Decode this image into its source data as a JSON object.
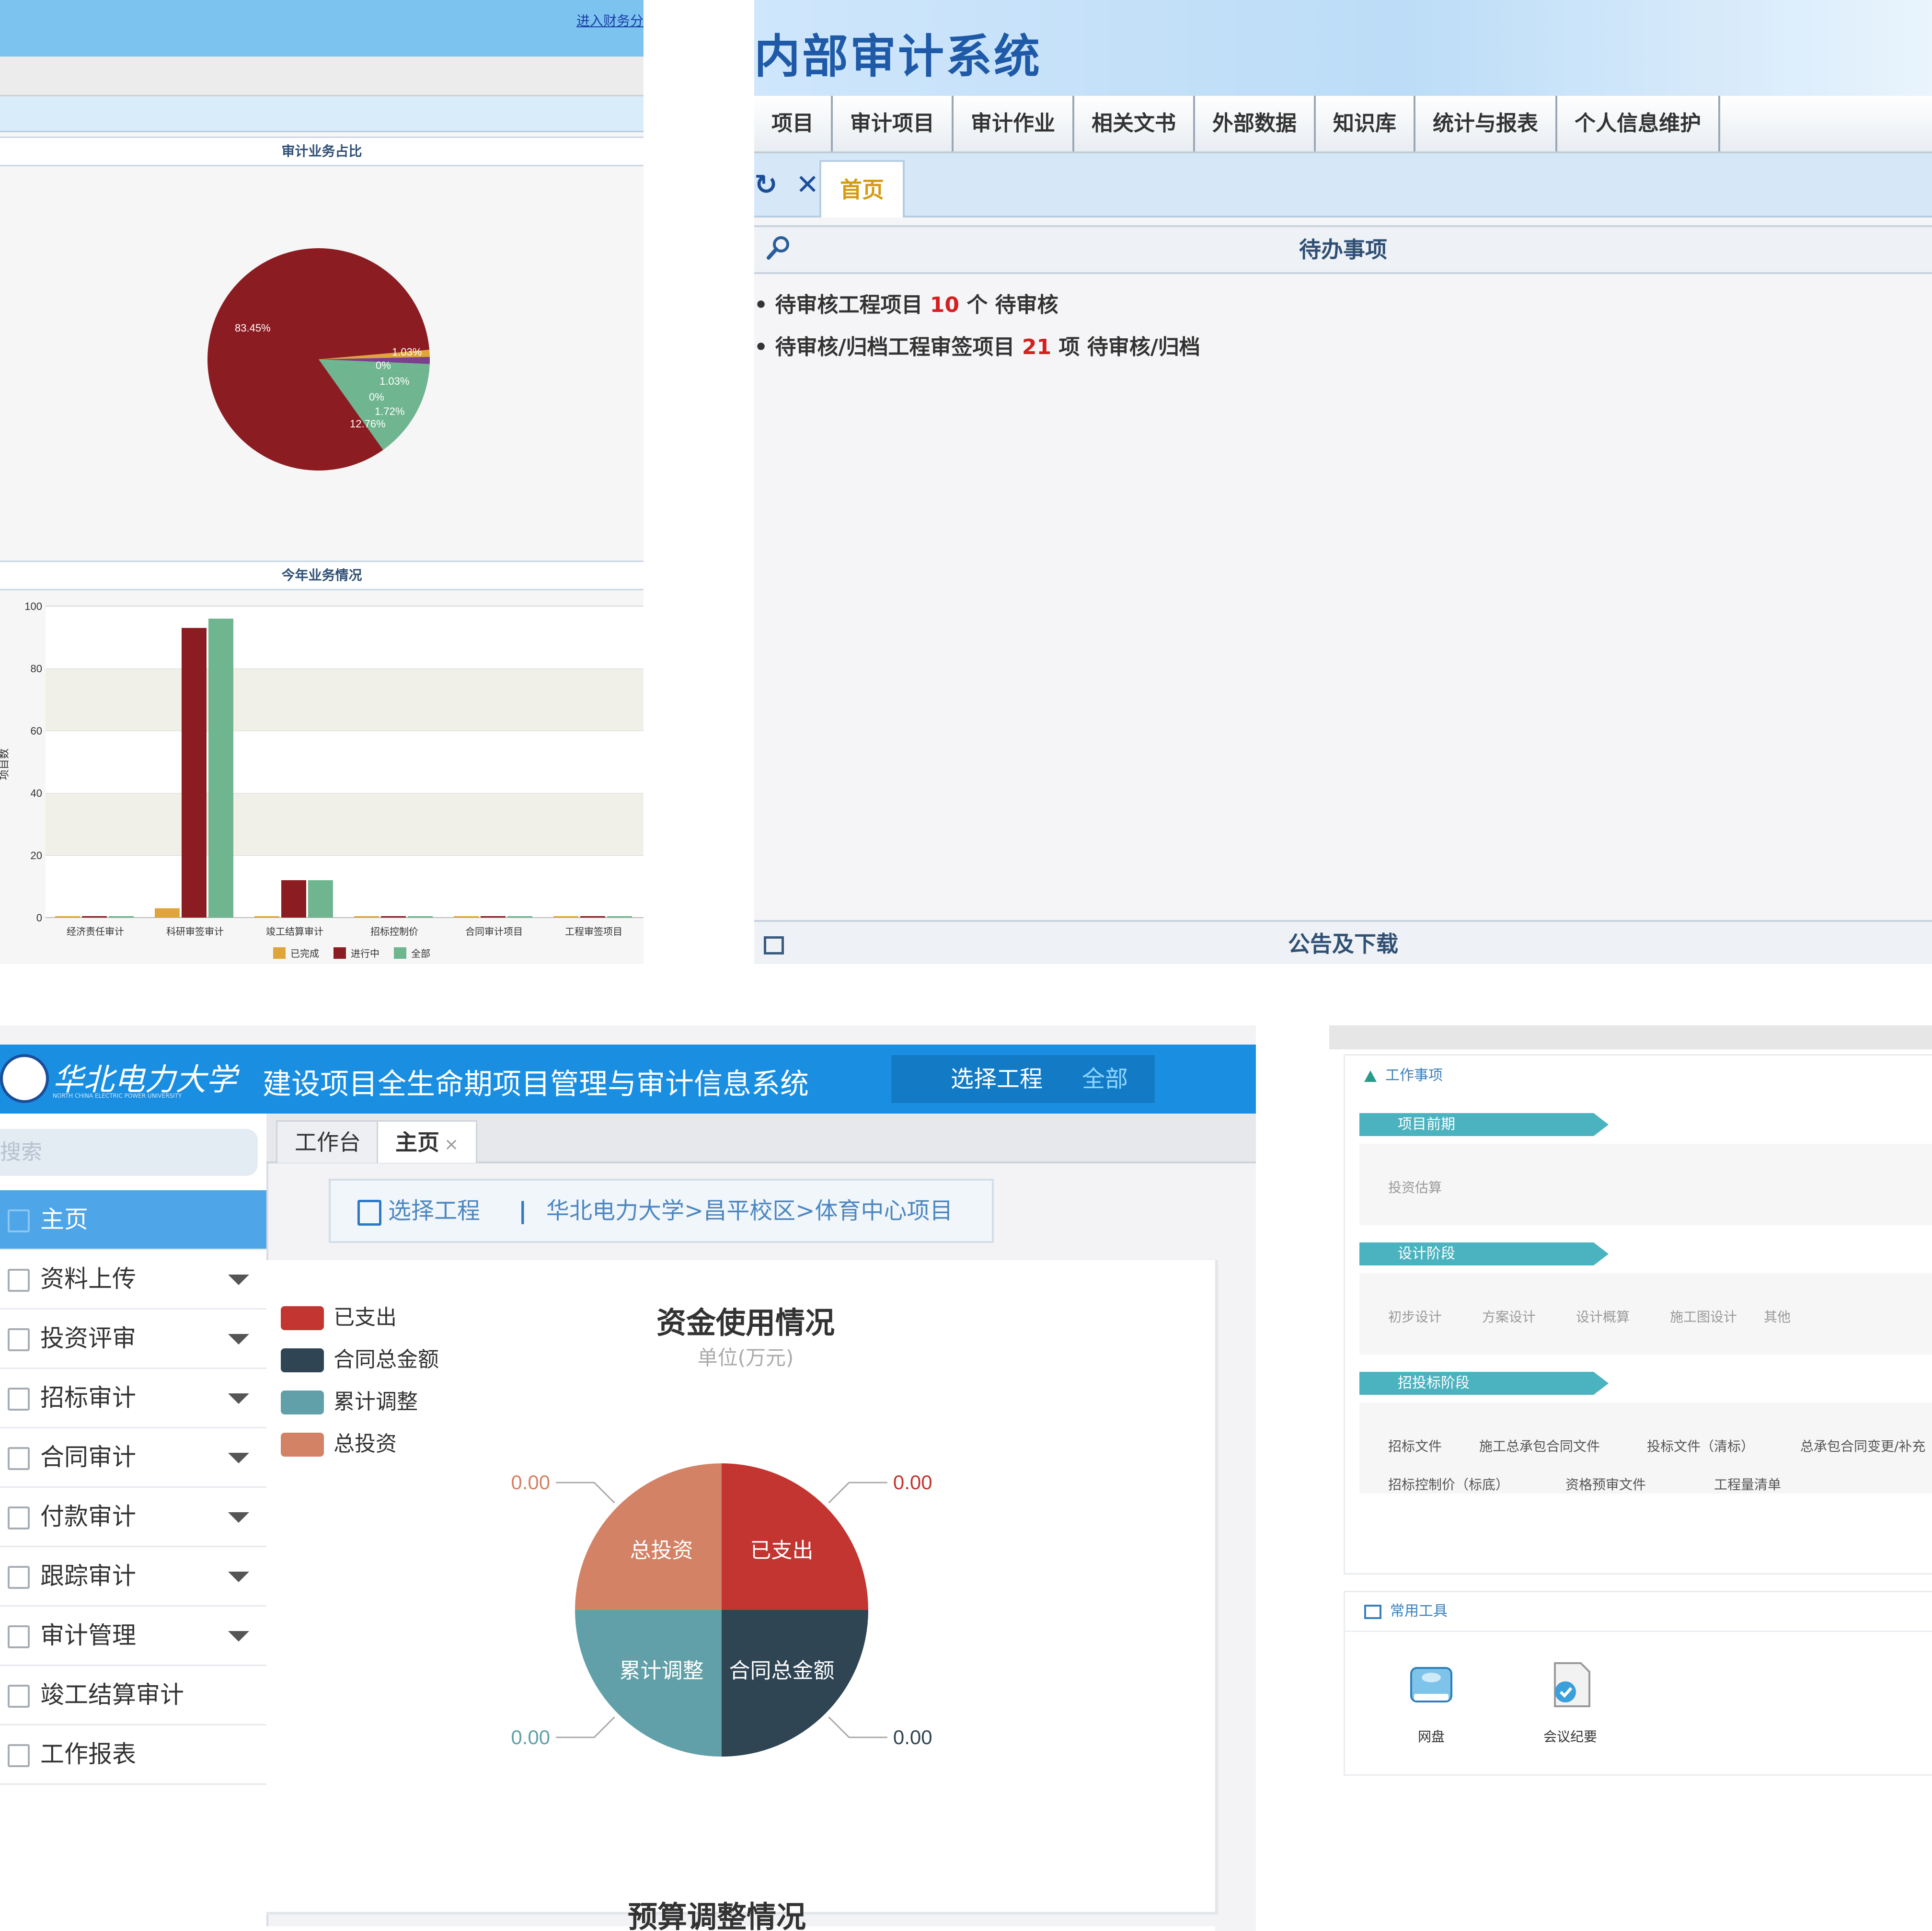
{
  "panel1": {
    "top_link": "进入财务分",
    "pie_section_title": "审计业务占比",
    "bar_section_title": "今年业务情况"
  },
  "panel2": {
    "system_title": "内部审计系统",
    "menu": [
      "项目",
      "审计项目",
      "审计作业",
      "相关文书",
      "外部数据",
      "知识库",
      "统计与报表",
      "个人信息维护"
    ],
    "home_tab": "首页",
    "todo_title": "待办事项",
    "todo_items": [
      {
        "before": "待审核工程项目 ",
        "num": "10",
        "after": " 个 待审核"
      },
      {
        "before": "待审核/归档工程审签项目 ",
        "num": "21",
        "after": " 项 待审核/归档"
      }
    ],
    "announce_title": "公告及下载"
  },
  "panel3": {
    "logo_text": "华北电力大学",
    "logo_subtext": "NORTH CHINA ELECTRIC POWER UNIVERSITY",
    "system_title": "建设项目全生命期项目管理与审计信息系统",
    "select_project_label": "选择工程",
    "select_project_value": "全部",
    "search_placeholder": "搜索",
    "nav": [
      {
        "label": "主页",
        "active": true,
        "arrow": false
      },
      {
        "label": "资料上传",
        "active": false,
        "arrow": true
      },
      {
        "label": "投资评审",
        "active": false,
        "arrow": true
      },
      {
        "label": "招标审计",
        "active": false,
        "arrow": true
      },
      {
        "label": "合同审计",
        "active": false,
        "arrow": true
      },
      {
        "label": "付款审计",
        "active": false,
        "arrow": true
      },
      {
        "label": "跟踪审计",
        "active": false,
        "arrow": true
      },
      {
        "label": "审计管理",
        "active": false,
        "arrow": true
      },
      {
        "label": "竣工结算审计",
        "active": false,
        "arrow": false
      },
      {
        "label": "工作报表",
        "active": false,
        "arrow": false
      }
    ],
    "tabs": [
      {
        "label": "工作台",
        "active": false
      },
      {
        "label": "主页",
        "active": true,
        "close": "×"
      }
    ],
    "crumb_select": "选择工程",
    "crumb_sep": "|",
    "crumb_path": "华北电力大学>昌平校区>体育中心项目",
    "fund_title": "资金使用情况",
    "fund_unit": "单位(万元)",
    "legend": [
      {
        "label": "已支出",
        "color": "#c23531"
      },
      {
        "label": "合同总金额",
        "color": "#2f4554"
      },
      {
        "label": "累计调整",
        "color": "#61a0a8"
      },
      {
        "label": "总投资",
        "color": "#d48265"
      }
    ],
    "budget_title": "预算调整情况"
  },
  "panel4": {
    "work_items_title": "工作事项",
    "stages": [
      {
        "label": "项目前期",
        "items": [
          "投资估算"
        ]
      },
      {
        "label": "设计阶段",
        "items": [
          "初步设计",
          "方案设计",
          "设计概算",
          "施工图设计",
          "其他"
        ]
      },
      {
        "label": "招投标阶段",
        "items": [
          "招标文件",
          "施工总承包合同文件",
          "投标文件（清标）",
          "总承包合同变更/补充",
          "招标控制价（标底）",
          "资格预审文件",
          "工程量清单"
        ]
      }
    ],
    "tools_title": "常用工具",
    "tools": [
      {
        "label": "网盘",
        "icon": "network-disk-icon"
      },
      {
        "label": "会议纪要",
        "icon": "meeting-minutes-icon"
      }
    ]
  },
  "chart_data": [
    {
      "type": "pie",
      "title": "审计业务占比",
      "slices": [
        {
          "value": 83.45,
          "label": "83.45%",
          "color": "#8b1c22"
        },
        {
          "value": 12.76,
          "label": "12.76%",
          "color": "#6fb58f"
        },
        {
          "value": 1.72,
          "label": "1.72%",
          "color": "#6fb58f"
        },
        {
          "value": 1.03,
          "label": "1.03%",
          "color": "#7a3f8f"
        },
        {
          "value": 0,
          "label": "0%",
          "color": "#7a3f8f"
        },
        {
          "value": 0,
          "label": "0%",
          "color": "#e0a53a"
        },
        {
          "value": 1.03,
          "label": "1.03%",
          "color": "#e0a53a"
        }
      ]
    },
    {
      "type": "bar",
      "title": "今年业务情况",
      "ylabel": "项目数",
      "ylim": [
        0,
        100
      ],
      "yticks": [
        0,
        20,
        40,
        60,
        80,
        100
      ],
      "categories": [
        "经济责任审计",
        "科研审签审计",
        "竣工结算审计",
        "招标控制价",
        "合同审计项目",
        "工程审签项目"
      ],
      "series": [
        {
          "name": "已完成",
          "color": "#e0a53a",
          "values": [
            0,
            3,
            0,
            0,
            0,
            0
          ]
        },
        {
          "name": "进行中",
          "color": "#8b1c22",
          "values": [
            0,
            93,
            12,
            0,
            0,
            0
          ]
        },
        {
          "name": "全部",
          "color": "#6fb58f",
          "values": [
            0,
            96,
            12,
            0,
            0,
            0
          ]
        }
      ]
    },
    {
      "type": "pie",
      "title": "资金使用情况",
      "subtitle": "单位(万元)",
      "slices": [
        {
          "label": "已支出",
          "value": 0.0,
          "display": "0.00",
          "color": "#c23531"
        },
        {
          "label": "合同总金额",
          "value": 0.0,
          "display": "0.00",
          "color": "#2f4554"
        },
        {
          "label": "累计调整",
          "value": 0.0,
          "display": "0.00",
          "color": "#61a0a8"
        },
        {
          "label": "总投资",
          "value": 0.0,
          "display": "0.00",
          "color": "#d48265"
        }
      ]
    }
  ]
}
